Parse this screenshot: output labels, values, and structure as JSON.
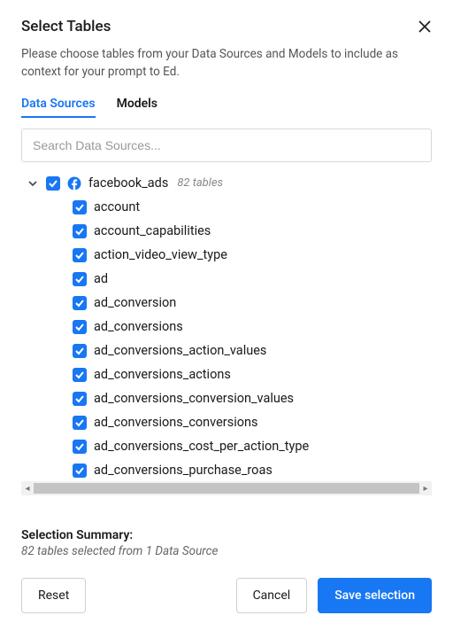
{
  "dialog": {
    "title": "Select Tables",
    "description": "Please choose tables from your Data Sources and Models to include as context for your prompt to Ed."
  },
  "tabs": {
    "data_sources": "Data Sources",
    "models": "Models",
    "active": "data_sources"
  },
  "search": {
    "placeholder": "Search Data Sources..."
  },
  "tree": {
    "source": {
      "name": "facebook_ads",
      "count_label": "82 tables",
      "checked": true,
      "expanded": true,
      "tables": [
        {
          "name": "account",
          "checked": true
        },
        {
          "name": "account_capabilities",
          "checked": true
        },
        {
          "name": "action_video_view_type",
          "checked": true
        },
        {
          "name": "ad",
          "checked": true
        },
        {
          "name": "ad_conversion",
          "checked": true
        },
        {
          "name": "ad_conversions",
          "checked": true
        },
        {
          "name": "ad_conversions_action_values",
          "checked": true
        },
        {
          "name": "ad_conversions_actions",
          "checked": true
        },
        {
          "name": "ad_conversions_conversion_values",
          "checked": true
        },
        {
          "name": "ad_conversions_conversions",
          "checked": true
        },
        {
          "name": "ad_conversions_cost_per_action_type",
          "checked": true
        },
        {
          "name": "ad_conversions_purchase_roas",
          "checked": true
        }
      ]
    }
  },
  "summary": {
    "title": "Selection Summary:",
    "text": "82 tables selected from 1 Data Source"
  },
  "buttons": {
    "reset": "Reset",
    "cancel": "Cancel",
    "save": "Save selection"
  }
}
